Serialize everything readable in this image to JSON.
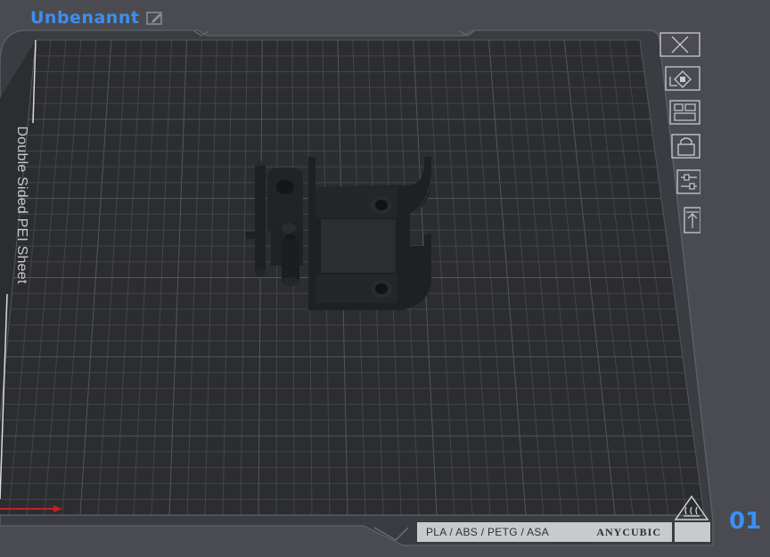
{
  "header": {
    "project_name": "Unbenannt"
  },
  "toolbar": {
    "tools": [
      {
        "name": "delete-all-icon"
      },
      {
        "name": "auto-arrange-icon"
      },
      {
        "name": "plate-layout-icon"
      },
      {
        "name": "lock-icon"
      },
      {
        "name": "plate-settings-icon"
      },
      {
        "name": "upload-icon"
      }
    ]
  },
  "bed": {
    "side_label": "Double Sided PEI Sheet",
    "filaments": "PLA / ABS / PETG / ASA",
    "brand": "ANYCUBIC",
    "plate_number": "01"
  },
  "colors": {
    "background": "#4a4b50",
    "bed_surface": "#2b2c30",
    "grid_line": "#43454b",
    "accent_blue": "#3f8df0",
    "axis_red": "#c62020",
    "model": "#1e1f22"
  }
}
